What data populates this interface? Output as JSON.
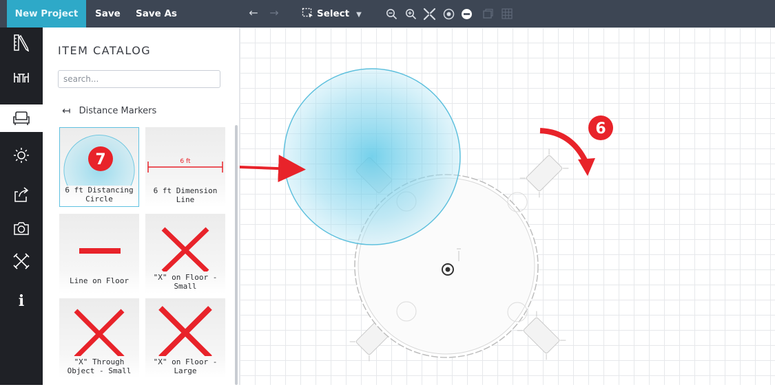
{
  "toolbar": {
    "new_project": "New Project",
    "save": "Save",
    "save_as": "Save As",
    "select": "Select"
  },
  "catalog": {
    "title": "ITEM CATALOG",
    "search_placeholder": "search...",
    "category": "Distance Markers",
    "items": [
      {
        "label": "6 ft Distancing Circle"
      },
      {
        "label": "6 ft Dimension Line",
        "thumb_text": "6 ft"
      },
      {
        "label": "Line on Floor"
      },
      {
        "label": "\"X\" on Floor - Small"
      },
      {
        "label": "\"X\" Through Object - Small"
      },
      {
        "label": "\"X\" on Floor - Large"
      }
    ]
  },
  "annotations": {
    "step_7": "7",
    "step_6": "6"
  },
  "colors": {
    "topbar": "#3d4654",
    "accent": "#2ea9c8",
    "rail": "#1f2126",
    "marker_red": "#e8232a",
    "circle_blue": "#7fd3ea"
  },
  "icons": [
    "undo-icon",
    "redo-icon",
    "select-icon",
    "zoom-out-icon",
    "zoom-in-icon",
    "fit-icon",
    "center-icon",
    "minus-circle-icon",
    "layer-icon",
    "grid-icon",
    "ruler-pencil-icon",
    "table-chairs-icon",
    "sofa-icon",
    "sun-icon",
    "export-icon",
    "camera-icon",
    "tools-icon",
    "info-icon",
    "arrow-left-icon"
  ]
}
